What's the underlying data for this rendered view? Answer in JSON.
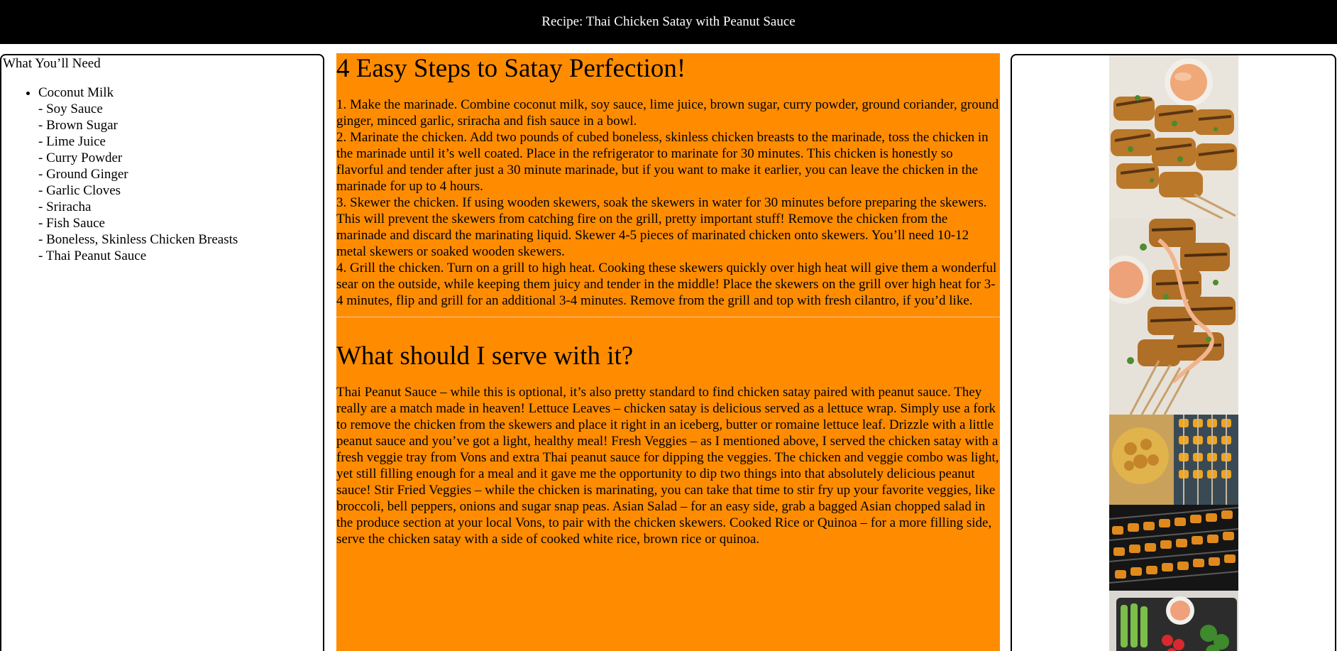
{
  "header": {
    "title": "Recipe: Thai Chicken Satay with Peanut Sauce"
  },
  "ingredients": {
    "heading": "What You’ll Need",
    "first": "Coconut Milk",
    "items": [
      "- Soy Sauce",
      "- Brown Sugar",
      "- Lime Juice",
      "- Curry Powder",
      "- Ground Ginger",
      "- Garlic Cloves",
      "- Sriracha",
      "- Fish Sauce",
      "- Boneless, Skinless Chicken Breasts",
      "- Thai Peanut Sauce"
    ]
  },
  "steps": {
    "heading": "4 Easy Steps to Satay Perfection!",
    "list": [
      "1. Make the marinade. Combine coconut milk, soy sauce, lime juice, brown sugar, curry powder, ground coriander, ground ginger, minced garlic, sriracha and fish sauce in a bowl.",
      "2. Marinate the chicken. Add two pounds of cubed boneless, skinless chicken breasts to the marinade, toss the chicken in the marinade until it’s well coated. Place in the refrigerator to marinate for 30 minutes. This chicken is honestly so flavorful and tender after just a 30 minute marinade, but if you want to make it earlier, you can leave the chicken in the marinade for up to 4 hours.",
      "3. Skewer the chicken. If using wooden skewers, soak the skewers in water for 30 minutes before preparing the skewers. This will prevent the skewers from catching fire on the grill, pretty important stuff! Remove the chicken from the marinade and discard the marinating liquid. Skewer 4-5 pieces of marinated chicken onto skewers. You’ll need 10-12 metal skewers or soaked wooden skewers.",
      "4. Grill the chicken. Turn on a grill to high heat. Cooking these skewers quickly over high heat will give them a wonderful sear on the outside, while keeping them juicy and tender in the middle! Place the skewers on the grill over high heat for 3-4 minutes, flip and grill for an additional 3-4 minutes. Remove from the grill and top with fresh cilantro, if you’d like."
    ]
  },
  "serve": {
    "heading": "What should I serve with it?",
    "body": "Thai Peanut Sauce – while this is optional, it’s also pretty standard to find chicken satay paired with peanut sauce. They really are a match made in heaven! Lettuce Leaves – chicken satay is delicious served as a lettuce wrap. Simply use a fork to remove the chicken from the skewers and place it right in an iceberg, butter or romaine lettuce leaf. Drizzle with a little peanut sauce and you’ve got a light, healthy meal! Fresh Veggies – as I mentioned above, I served the chicken satay with a fresh veggie tray from Vons and extra Thai peanut sauce for dipping the veggies. The chicken and veggie combo was light, yet still filling enough for a meal and it gave me the opportunity to dip two things into that absolutely delicious peanut sauce! Stir Fried Veggies – while the chicken is marinating, you can take that time to stir fry up your favorite veggies, like broccoli, bell peppers, onions and sugar snap peas. Asian Salad – for an easy side, grab a bagged Asian chopped salad in the produce section at your local Vons, to pair with the chicken skewers. Cooked Rice or Quinoa – for a more filling side, serve the chicken satay with a side of cooked white rice, brown rice or quinoa."
  },
  "photos": {
    "items": [
      {
        "icon": "satay-platter-photo"
      },
      {
        "icon": "satay-skewers-sauce-photo"
      },
      {
        "icon": "marinade-and-skewers-photo"
      },
      {
        "icon": "grilling-skewers-photo"
      },
      {
        "icon": "veggie-tray-photo"
      }
    ]
  },
  "colors": {
    "header_bg": "#000000",
    "header_text": "#ffffff",
    "content_bg": "#ff8c00",
    "border": "#000000"
  }
}
